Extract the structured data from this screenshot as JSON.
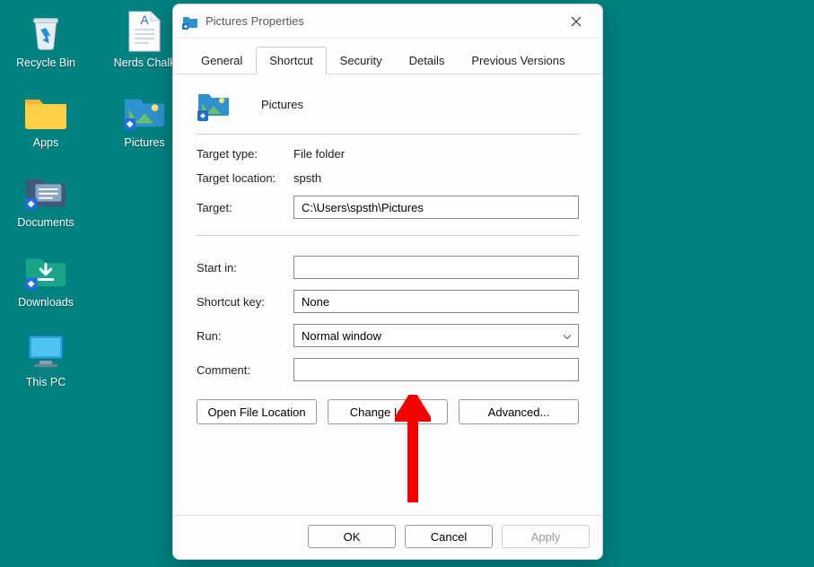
{
  "desktop": {
    "icons": [
      {
        "id": "recycle-bin",
        "label": "Recycle Bin"
      },
      {
        "id": "nerds-chalk",
        "label": "Nerds Chalk"
      },
      {
        "id": "apps",
        "label": "Apps"
      },
      {
        "id": "pictures",
        "label": "Pictures"
      },
      {
        "id": "documents",
        "label": "Documents"
      },
      {
        "id": "downloads",
        "label": "Downloads"
      },
      {
        "id": "this-pc",
        "label": "This PC"
      }
    ]
  },
  "dialog": {
    "title": "Pictures Properties",
    "tabs": [
      "General",
      "Shortcut",
      "Security",
      "Details",
      "Previous Versions"
    ],
    "active_tab": "Shortcut",
    "shortcut": {
      "name": "Pictures",
      "target_type_label": "Target type:",
      "target_type": "File folder",
      "target_location_label": "Target location:",
      "target_location": "spsth",
      "target_label": "Target:",
      "target": "C:\\Users\\spsth\\Pictures",
      "start_in_label": "Start in:",
      "start_in": "",
      "shortcut_key_label": "Shortcut key:",
      "shortcut_key": "None",
      "run_label": "Run:",
      "run": "Normal window",
      "comment_label": "Comment:",
      "comment": "",
      "open_file_location": "Open File Location",
      "change_icon": "Change Icon...",
      "advanced": "Advanced..."
    },
    "footer": {
      "ok": "OK",
      "cancel": "Cancel",
      "apply": "Apply"
    }
  }
}
